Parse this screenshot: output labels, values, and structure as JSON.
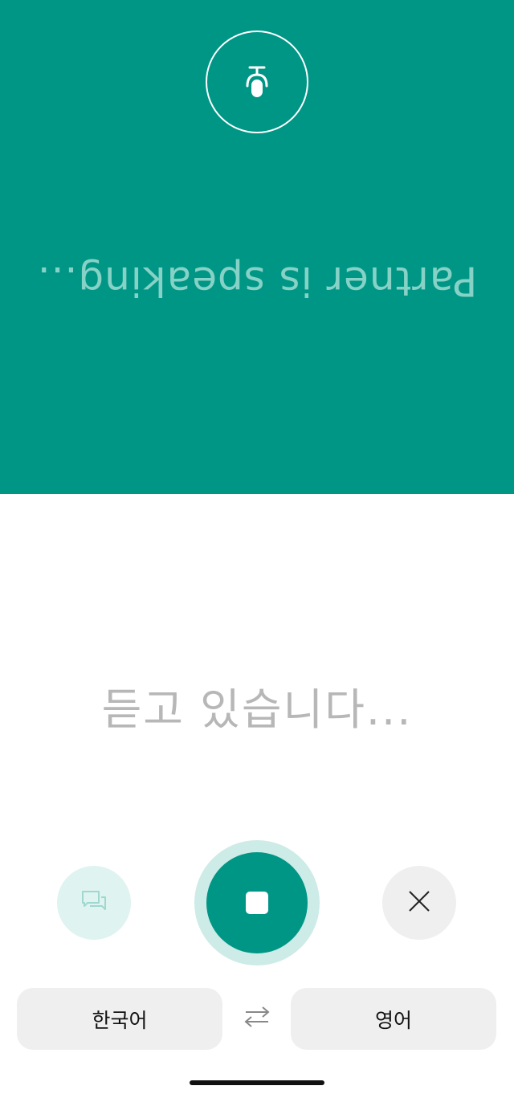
{
  "partner": {
    "status": "Partner is speaking...",
    "mic_icon": "microphone-icon"
  },
  "self": {
    "status": "듣고 있습니다..."
  },
  "controls": {
    "conversation_icon": "conversation-bubbles-icon",
    "stop_icon": "stop-icon",
    "close_icon": "close-icon"
  },
  "languages": {
    "source": "한국어",
    "target": "영어",
    "swap_icon": "swap-arrows-icon"
  },
  "colors": {
    "accent": "#009686",
    "accent_light": "#cdebe7",
    "partner_text": "#86d2c6",
    "muted_text": "#b7b7b7"
  }
}
